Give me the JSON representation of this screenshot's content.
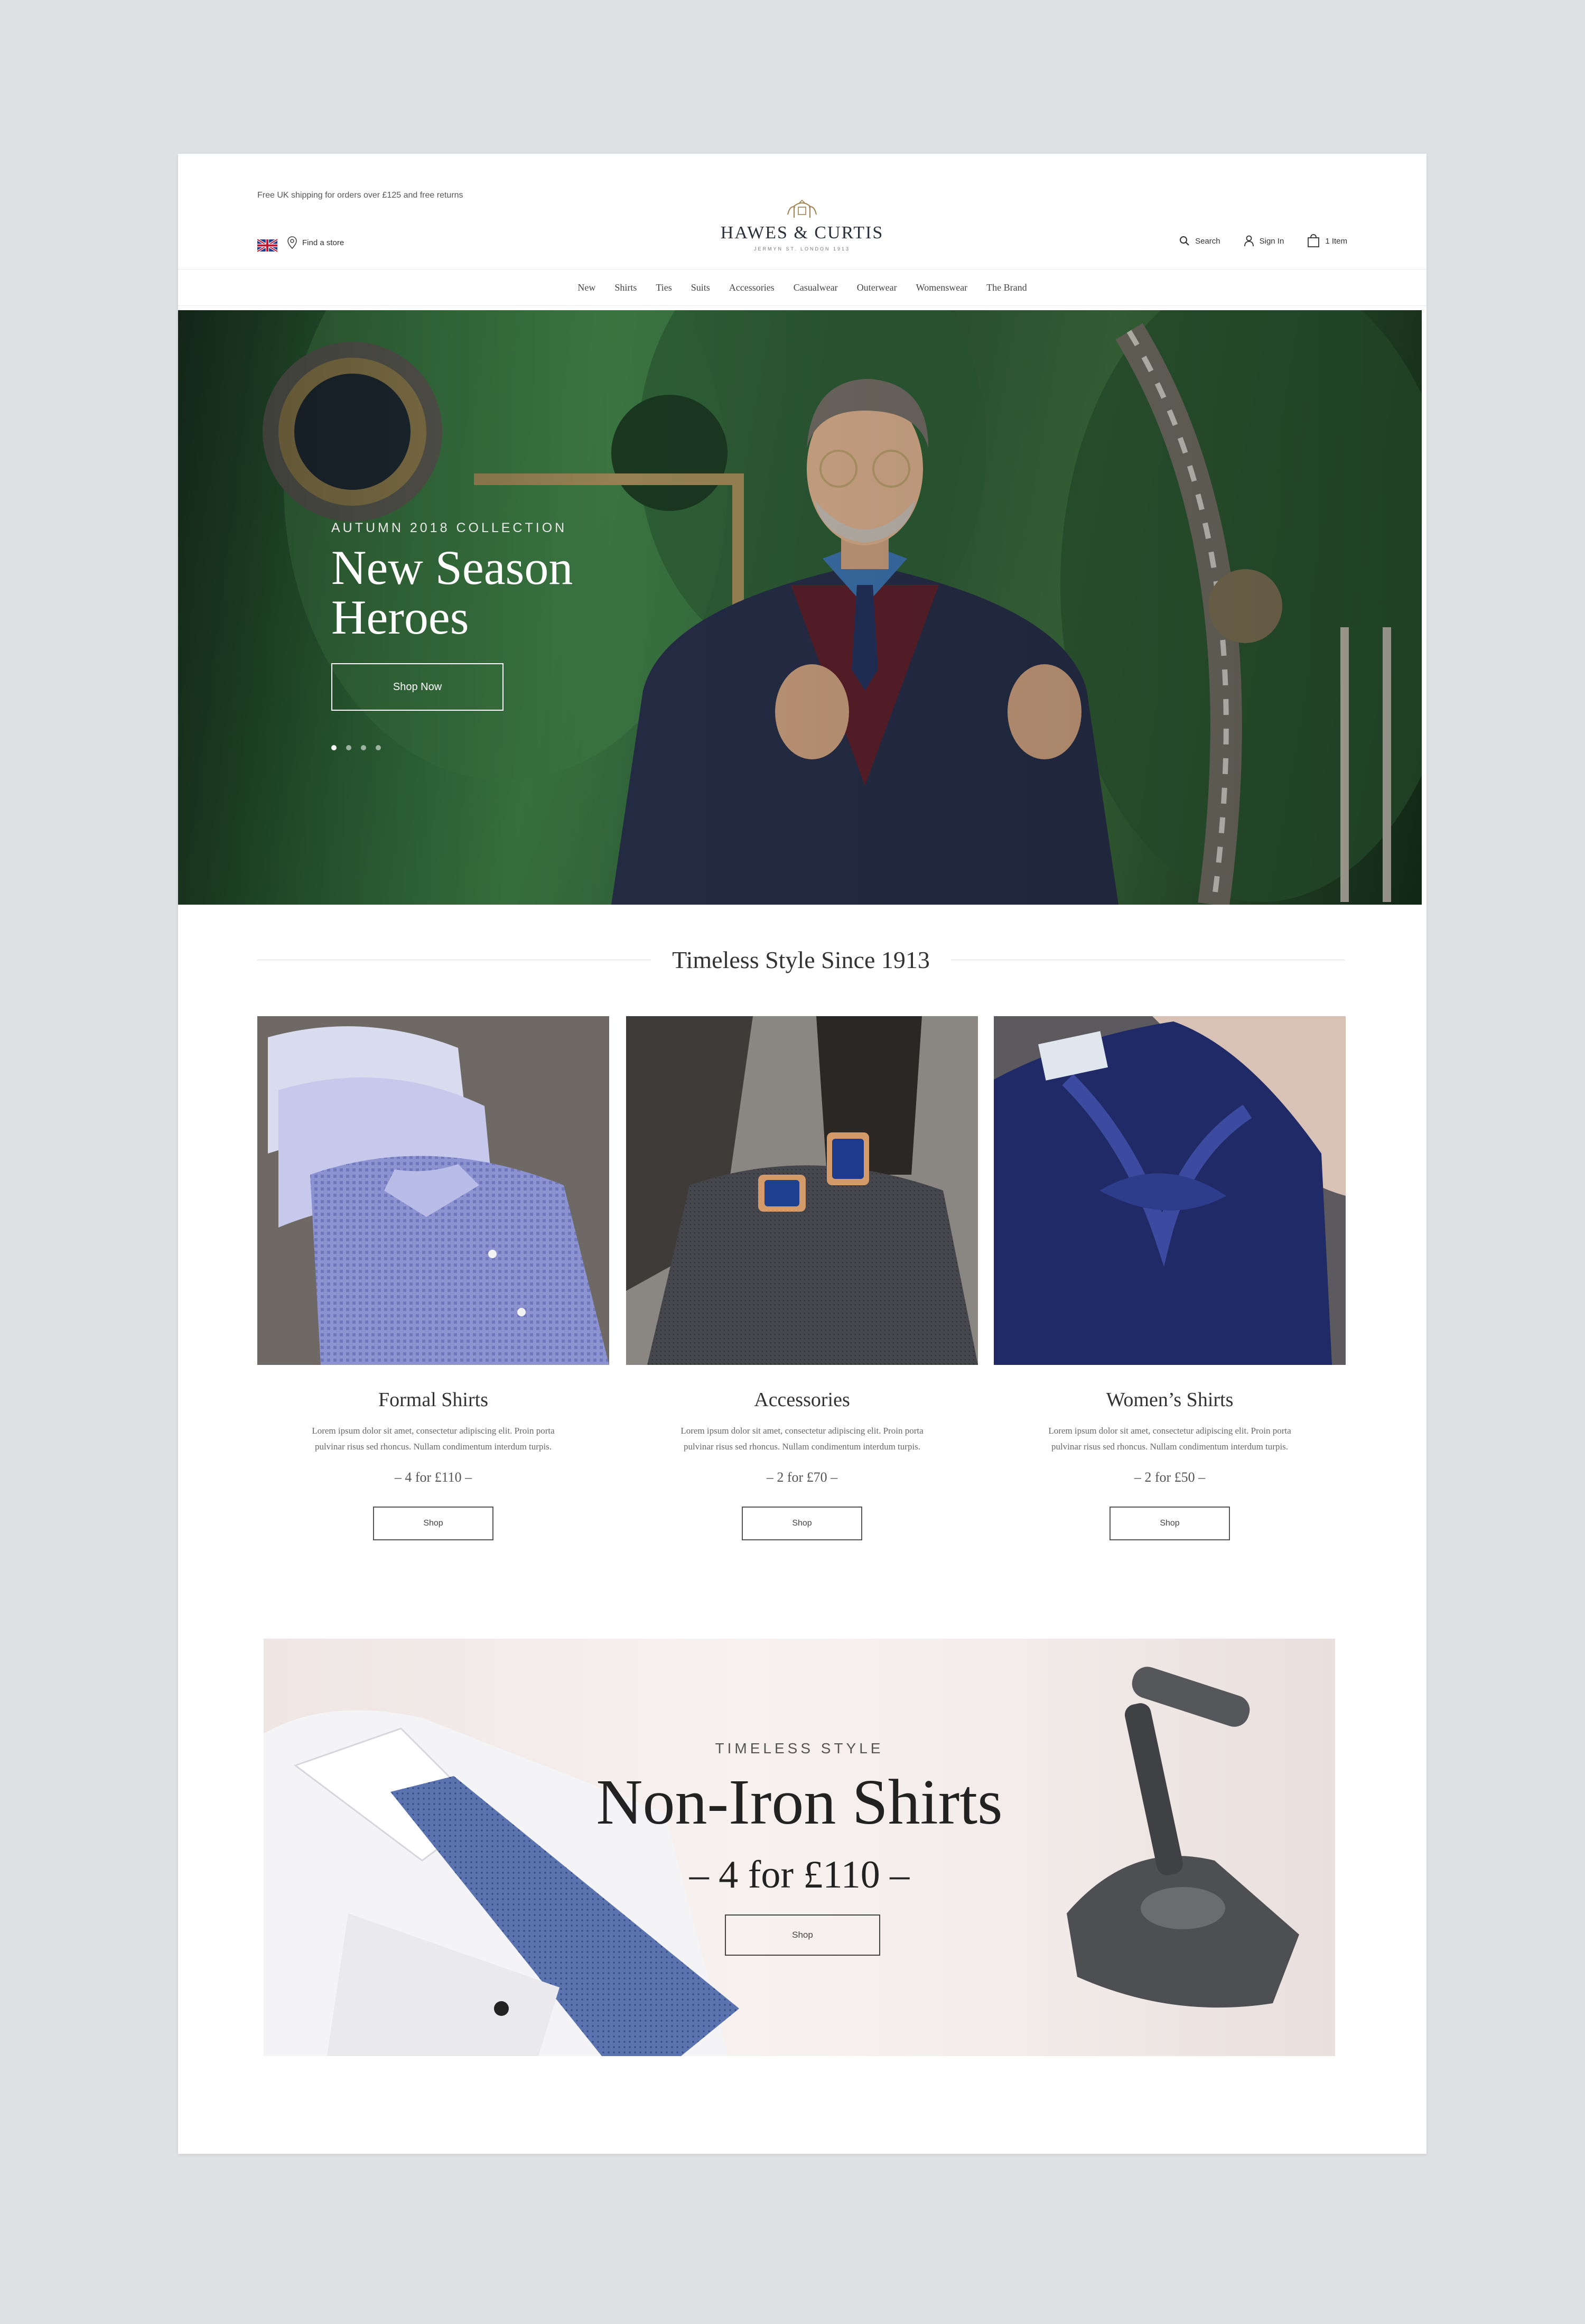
{
  "header": {
    "promo_text": "Free UK shipping for orders over £125 and free returns",
    "find_store": "Find a store",
    "logo_text": "HAWES & CURTIS",
    "logo_sub": "JERMYN ST. LONDON 1913",
    "search": "Search",
    "sign_in": "Sign In",
    "bag": "1 Item"
  },
  "nav": {
    "items": [
      "New",
      "Shirts",
      "Ties",
      "Suits",
      "Accessories",
      "Casualwear",
      "Outerwear",
      "Womenswear",
      "The Brand"
    ]
  },
  "hero": {
    "eyebrow": "AUTUMN 2018 COLLECTION",
    "title_line1": "New Season",
    "title_line2": "Heroes",
    "button": "Shop Now",
    "slide_count": 4,
    "active_slide": 1
  },
  "section": {
    "title": "Timeless Style Since 1913"
  },
  "cards": [
    {
      "title": "Formal Shirts",
      "desc": "Lorem ipsum dolor sit amet, consectetur adipiscing elit. Proin porta pulvinar risus sed rhoncus. Nullam condimentum interdum turpis.",
      "offer": "– 4 for £110 –",
      "button": "Shop"
    },
    {
      "title": "Accessories",
      "desc": "Lorem ipsum dolor sit amet, consectetur adipiscing elit. Proin porta pulvinar risus sed rhoncus. Nullam condimentum interdum turpis.",
      "offer": "– 2 for £70 –",
      "button": "Shop"
    },
    {
      "title": "Women’s Shirts",
      "desc": "Lorem ipsum dolor sit amet, consectetur adipiscing elit. Proin porta pulvinar risus sed rhoncus. Nullam condimentum interdum turpis.",
      "offer": "– 2 for £50 –",
      "button": "Shop"
    }
  ],
  "banner": {
    "eyebrow": "TIMELESS STYLE",
    "title": "Non-Iron Shirts",
    "offer": "– 4 for £110 –",
    "button": "Shop"
  },
  "colors": {
    "backdrop": "#dde1e3",
    "page": "#ffffff",
    "navy": "#2a2f3a",
    "hero_green": "#2f6b3a"
  }
}
